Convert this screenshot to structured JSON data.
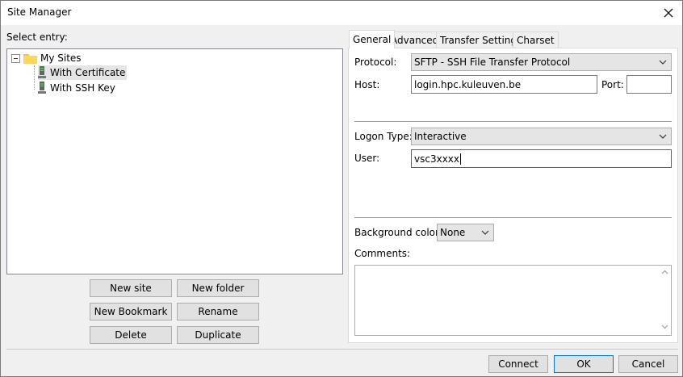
{
  "window": {
    "title": "Site Manager"
  },
  "left": {
    "select_label": "Select entry:",
    "tree": {
      "root": {
        "label": "My Sites",
        "expander": "⊟"
      },
      "children": [
        {
          "label": "With Certificate",
          "selected": true
        },
        {
          "label": "With SSH Key",
          "selected": false
        }
      ]
    },
    "buttons": {
      "new_site": "New site",
      "new_folder": "New folder",
      "new_bookmark": "New Bookmark",
      "rename": "Rename",
      "delete": "Delete",
      "duplicate": "Duplicate"
    }
  },
  "tabs": [
    {
      "label": "General",
      "active": true
    },
    {
      "label": "Advanced",
      "active": false
    },
    {
      "label": "Transfer Settings",
      "active": false
    },
    {
      "label": "Charset",
      "active": false
    }
  ],
  "general": {
    "protocol_label": "Protocol:",
    "protocol_value": "SFTP - SSH File Transfer Protocol",
    "host_label": "Host:",
    "host_value": "login.hpc.kuleuven.be",
    "port_label": "Port:",
    "port_value": "",
    "logon_type_label": "Logon Type:",
    "logon_type_value": "Interactive",
    "user_label": "User:",
    "user_value": "vsc3xxxx",
    "bg_color_label": "Background color:",
    "bg_color_value": "None",
    "comments_label": "Comments:",
    "comments_value": ""
  },
  "footer": {
    "connect": "Connect",
    "ok": "OK",
    "cancel": "Cancel"
  },
  "colors": {
    "accent": "#0078d7",
    "folder": "#f5c342"
  }
}
